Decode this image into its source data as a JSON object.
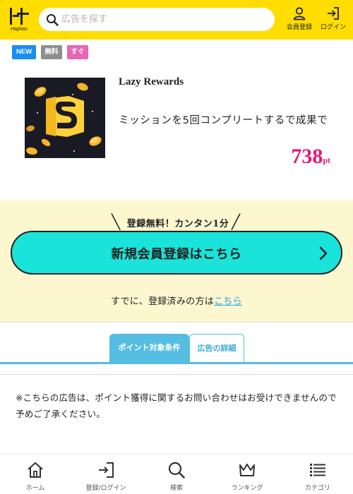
{
  "header": {
    "logo_text": "Hapitas",
    "search_placeholder": "広告を探す",
    "register_label": "会員登録",
    "login_label": "ログイン"
  },
  "tags": {
    "new": "NEW",
    "free": "無料",
    "soon": "すぐ"
  },
  "ad": {
    "title": "Lazy Rewards",
    "description": "ミッションを5回コンプリートするで成果で",
    "points": "738",
    "points_unit": "pt"
  },
  "register": {
    "tagline": "登録無料！カンタン1分",
    "button_label": "新規会員登録はこちら",
    "login_prompt": "すでに、登録済みの方は",
    "login_link": "こちら"
  },
  "tabs": [
    {
      "label": "ポイント対象条件"
    },
    {
      "label": "広告の詳細"
    }
  ],
  "notice": "※こちらの広告は、ポイント獲得に関するお問い合わせはお受けできませんので予めご了承ください。",
  "bottom_nav": [
    {
      "label": "ホーム",
      "icon": "home-icon"
    },
    {
      "label": "登録/ログイン",
      "icon": "login-icon"
    },
    {
      "label": "検索",
      "icon": "search-icon"
    },
    {
      "label": "ランキング",
      "icon": "crown-icon"
    },
    {
      "label": "カテゴリ",
      "icon": "list-icon"
    }
  ],
  "colors": {
    "brand_yellow": "#ffdd00",
    "accent_cyan": "#1ae3d9",
    "tab_blue": "#55bde0",
    "points_pink": "#e6157a",
    "band_cream": "#fdf7d0"
  }
}
